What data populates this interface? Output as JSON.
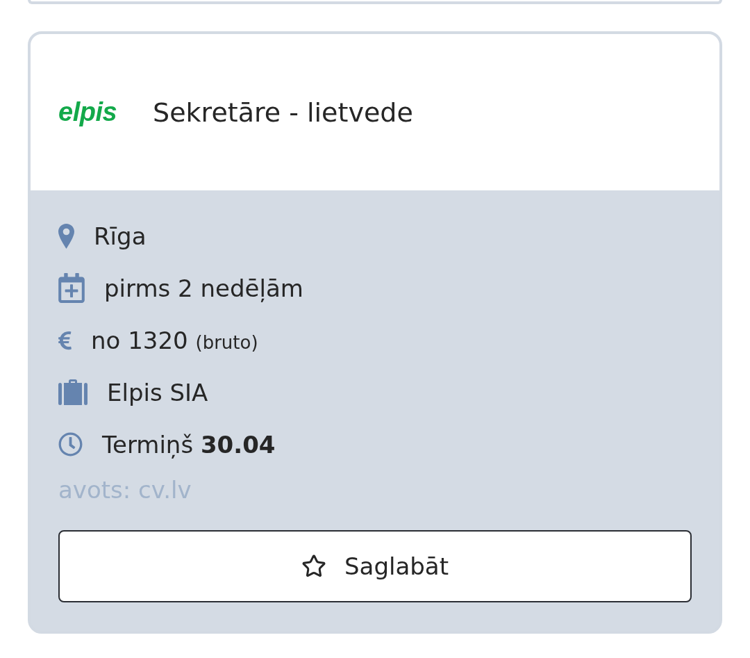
{
  "job_card": {
    "logo": {
      "text": "elpis"
    },
    "title": "Sekretāre - lietvede",
    "details": [
      {
        "kind": "location",
        "text": "Rīga"
      },
      {
        "kind": "posted",
        "text": "pirms 2 nedēļām"
      },
      {
        "kind": "salary",
        "text": "no 1320",
        "note": "(bruto)"
      },
      {
        "kind": "company",
        "text": "Elpis SIA"
      },
      {
        "kind": "deadline",
        "text": "Termiņš **30.04**"
      }
    ],
    "source": "avots: cv.lv",
    "save_button": {
      "label": "Saglabāt"
    }
  }
}
